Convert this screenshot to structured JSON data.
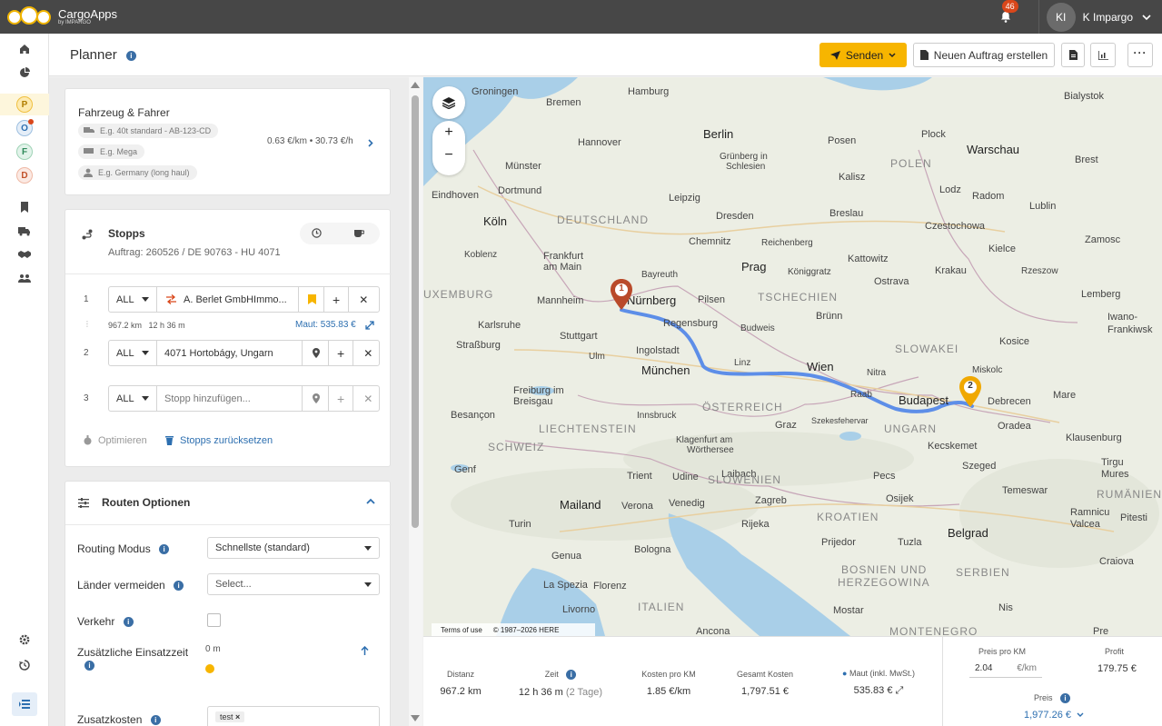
{
  "app": {
    "name": "CargoApps",
    "by": "by IMPARGO"
  },
  "topbar": {
    "notifications": "46",
    "user_initials": "KI",
    "user_name": "K Impargo"
  },
  "sidebar": {
    "letters": [
      "P",
      "O",
      "F",
      "D"
    ]
  },
  "header": {
    "title": "Planner",
    "send_label": "Senden",
    "new_order_label": "Neuen Auftrag erstellen"
  },
  "vehicle": {
    "title": "Fahrzeug & Fahrer",
    "truck_placeholder": "E.g. 40t standard - AB-123-CD",
    "trailer_placeholder": "E.g. Mega",
    "driver_placeholder": "E.g. Germany (long haul)",
    "rate": "0.63 €/km • 30.73 €/h"
  },
  "stops": {
    "title": "Stopps",
    "order": "Auftrag: 260526 / DE 90763 - HU 4071",
    "rows": [
      {
        "num": "1",
        "type": "ALL",
        "name": "A. Berlet GmbHImmo..."
      },
      {
        "num": "2",
        "type": "ALL",
        "name": "4071 Hortobágy, Ungarn"
      },
      {
        "num": "3",
        "type": "ALL",
        "name": "Stopp hinzufügen..."
      }
    ],
    "leg_distance": "967.2 km",
    "leg_time": "12 h 36 m",
    "toll": "Maut: 535.83 €",
    "optimize_label": "Optimieren",
    "reset_label": "Stopps zurücksetzen"
  },
  "route_options": {
    "title": "Routen Optionen",
    "routing_mode_label": "Routing Modus",
    "routing_mode_value": "Schnellste (standard)",
    "avoid_countries_label": "Länder vermeiden",
    "avoid_countries_placeholder": "Select...",
    "traffic_label": "Verkehr",
    "extra_time_label": "Zusätzliche Einsatzzeit",
    "extra_time_value": "0 m",
    "extra_cost_label": "Zusatzkosten",
    "extra_cost_tag": "test"
  },
  "map": {
    "terms": "Terms of use",
    "copyright": "© 1987–2026 HERE",
    "markers": [
      "1",
      "2"
    ],
    "labels": {
      "groningen": "Groningen",
      "bremen": "Bremen",
      "hamburg": "Hamburg",
      "bialystok": "Bialystok",
      "hannover": "Hannover",
      "berlin": "Berlin",
      "posen": "Posen",
      "warschau": "Warschau",
      "brest": "Brest",
      "gruenberg1": "Grünberg in",
      "gruenberg2": "Schlesien",
      "plock": "Plock",
      "muenster": "Münster",
      "polen": "POLEN",
      "kalisz": "Kalisz",
      "dortmund": "Dortmund",
      "leipzig": "Leipzig",
      "lodz": "Lodz",
      "eindhoven": "Eindhoven",
      "radom": "Radom",
      "lublin": "Lublin",
      "koeln": "Köln",
      "deutschland": "DEUTSCHLAND",
      "dresden": "Dresden",
      "breslau": "Breslau",
      "czestochowa": "Czestochowa",
      "koblenz": "Koblenz",
      "chemnitz": "Chemnitz",
      "reichenberg": "Reichenberg",
      "kielce": "Kielce",
      "zamosc": "Zamosc",
      "frankfurt1": "Frankfurt",
      "frankfurt2": "am Main",
      "kattowitz": "Kattowitz",
      "krakau": "Krakau",
      "rzeszow": "Rzeszow",
      "bayreuth": "Bayreuth",
      "prag": "Prag",
      "koeniggraetz": "Königgratz",
      "ostrava": "Ostrava",
      "luxemburg": "UXEMBURG",
      "mannheim": "Mannheim",
      "nuernberg": "Nürnberg",
      "pilsen": "Pilsen",
      "tschechien": "TSCHECHIEN",
      "lemberg": "Lemberg",
      "bruenn": "Brünn",
      "ivano1": "Iwano-",
      "ivano2": "Frankiwsk",
      "karlsruhe": "Karlsruhe",
      "regensburg": "Regensburg",
      "budweis": "Budweis",
      "slowakei": "SLOWAKEI",
      "kosice": "Kosice",
      "strassburg": "Straßburg",
      "stuttgart": "Stuttgart",
      "ingolstadt": "Ingolstadt",
      "linz": "Linz",
      "wien": "Wien",
      "nitra": "Nitra",
      "miskolc": "Miskolc",
      "ulm": "Ulm",
      "muenchen": "München",
      "freiburg1": "Freiburg im",
      "freiburg2": "Breisgau",
      "raab": "Raab",
      "budapest": "Budapest",
      "debrecen": "Debrecen",
      "oesterreich": "ÖSTERREICH",
      "mare": "Mare",
      "innsbruck": "Innsbruck",
      "besancon": "Besançon",
      "szekesfehervar": "Szekesfehervar",
      "oradea": "Oradea",
      "liechtenstein": "LIECHTENSTEIN",
      "graz": "Graz",
      "ungarn": "UNGARN",
      "schweiz": "SCHWEIZ",
      "klagenfurt1": "Klagenfurt am",
      "klagenfurt2": "Wörthersee",
      "kecskemet": "Kecskemet",
      "klausenburg": "Klausenburg",
      "genf": "Genf",
      "trient": "Trient",
      "udine": "Udine",
      "laibach": "Laibach",
      "pecs": "Pecs",
      "szeged": "Szeged",
      "tirgu1": "Tirgu",
      "tirgu2": "Mures",
      "slowenien": "SLOWENIEN",
      "temeswar": "Temeswar",
      "rumaenien": "RUMÄNIEN",
      "mailand": "Mailand",
      "verona": "Verona",
      "venedig": "Venedig",
      "zagreb": "Zagreb",
      "osijek": "Osijek",
      "turin": "Turin",
      "rijeka": "Rijeka",
      "kroatien": "KROATIEN",
      "belgrad": "Belgrad",
      "ramnicu": "Ramnicu",
      "valcea": "Valcea",
      "pitesti": "Pitesti",
      "genua": "Genua",
      "bologna": "Bologna",
      "prijedor": "Prijedor",
      "tuzla": "Tuzla",
      "craiova": "Craiova",
      "bosnien": "BOSNIEN UND",
      "herzegowina": "HERZEGOWINA",
      "serbien": "SERBIEN",
      "laspezia": "La Spezia",
      "florenz": "Florenz",
      "nis": "Nis",
      "livorno": "Livorno",
      "italien": "ITALIEN",
      "mostar": "Mostar",
      "montenegro": "MONTENEGRO",
      "ancona": "Ancona",
      "pre": "Pre"
    }
  },
  "stats": {
    "distance_label": "Distanz",
    "distance_value": "967.2 km",
    "time_label": "Zeit",
    "time_value": "12 h 36 m",
    "time_days": "(2 Tage)",
    "cost_per_km_label": "Kosten pro KM",
    "cost_per_km_value": "1.85 €/km",
    "total_cost_label": "Gesamt Kosten",
    "total_cost_value": "1,797.51 €",
    "toll_label": "Maut (inkl. MwSt.)",
    "toll_value": "535.83 €",
    "price_per_km_label": "Preis pro KM",
    "price_per_km_value": "2.04",
    "price_per_km_unit": "€/km",
    "profit_label": "Profit",
    "profit_value": "179.75 €",
    "price_label": "Preis",
    "price_value": "1,977.26 €"
  }
}
